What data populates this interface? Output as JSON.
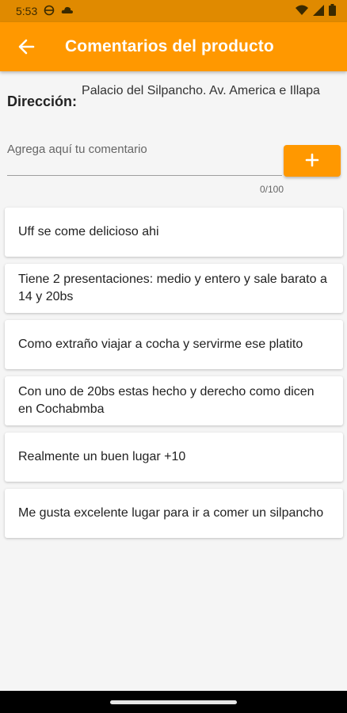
{
  "status_bar": {
    "time": "5:53"
  },
  "app_bar": {
    "title": "Comentarios del producto"
  },
  "address": {
    "label": "Dirección:",
    "value": "Palacio del Silpancho. Av. America e Illapa"
  },
  "comment_input": {
    "placeholder": "Agrega aquí tu comentario",
    "value": "",
    "counter": "0/100"
  },
  "add_button": {
    "label": "+"
  },
  "comments": [
    "Uff se come delicioso ahi",
    "Tiene 2 presentaciones: medio y entero y sale barato a 14 y 20bs",
    "Como extraño viajar a cocha y servirme ese platito",
    "Con uno de 20bs estas hecho y derecho como dicen en Cochabmba",
    "Realmente un buen lugar +10",
    "Me gusta excelente lugar para ir a comer un silpancho"
  ],
  "colors": {
    "primary": "#ff9800",
    "status_bar": "#e08a00",
    "background": "#f5f5f5"
  },
  "icons": [
    "sync-icon",
    "cloud-icon",
    "wifi-icon",
    "signal-icon",
    "battery-icon",
    "back-arrow-icon",
    "plus-icon"
  ]
}
